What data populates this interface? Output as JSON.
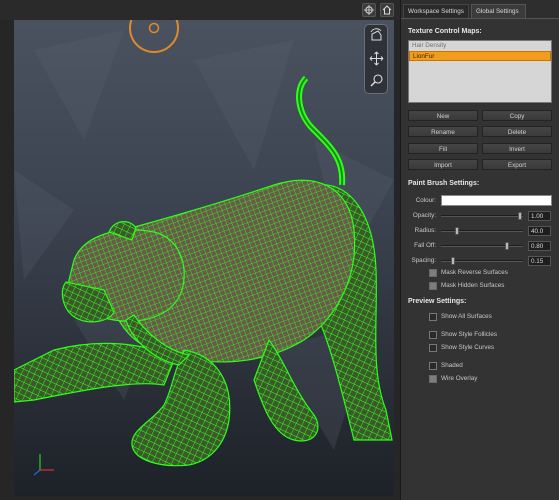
{
  "panel": {
    "tabs": [
      {
        "label": "Workspace Settings",
        "active": false
      },
      {
        "label": "Global Settings",
        "active": true
      }
    ],
    "texture_maps": {
      "title": "Texture Control Maps:",
      "items": [
        {
          "label": "Hair Density",
          "selected": false
        },
        {
          "label": "LionFur",
          "selected": true
        }
      ]
    },
    "buttons": {
      "new": "New",
      "copy": "Copy",
      "rename": "Rename",
      "delete": "Delete",
      "fill": "Fill",
      "invert": "Invert",
      "import": "Import",
      "export": "Export"
    },
    "paint_brush": {
      "title": "Paint Brush Settings:",
      "colour_label": "Colour:",
      "colour_value": "#ffffff",
      "sliders": [
        {
          "label": "Opacity:",
          "value": "1.00",
          "fraction": 1.0
        },
        {
          "label": "Radius:",
          "value": "40.0",
          "fraction": 0.2
        },
        {
          "label": "Fall Off:",
          "value": "0.80",
          "fraction": 0.8
        },
        {
          "label": "Spacing:",
          "value": "0.15",
          "fraction": 0.15
        }
      ],
      "checks": [
        {
          "label": "Mask Reverse Surfaces",
          "checked": true
        },
        {
          "label": "Mask Hidden Surfaces",
          "checked": true
        }
      ]
    },
    "preview": {
      "title": "Preview Settings:",
      "checks": [
        {
          "label": "Show All Surfaces",
          "checked": false
        },
        {
          "label": "Show Style Follicles",
          "checked": false
        },
        {
          "label": "Show Style Curves",
          "checked": false
        },
        {
          "label": "Shaded",
          "checked": false
        },
        {
          "label": "Wire Overlay",
          "checked": true
        }
      ]
    }
  },
  "viewport": {
    "top_icons": [
      "crosshair-icon",
      "home-icon"
    ],
    "tools": [
      "rotate-camera-icon",
      "pan-icon",
      "zoom-icon"
    ],
    "wireframe_color": "#2dff1a",
    "background_top": "#4a5260",
    "background_bottom": "#1d2128"
  }
}
